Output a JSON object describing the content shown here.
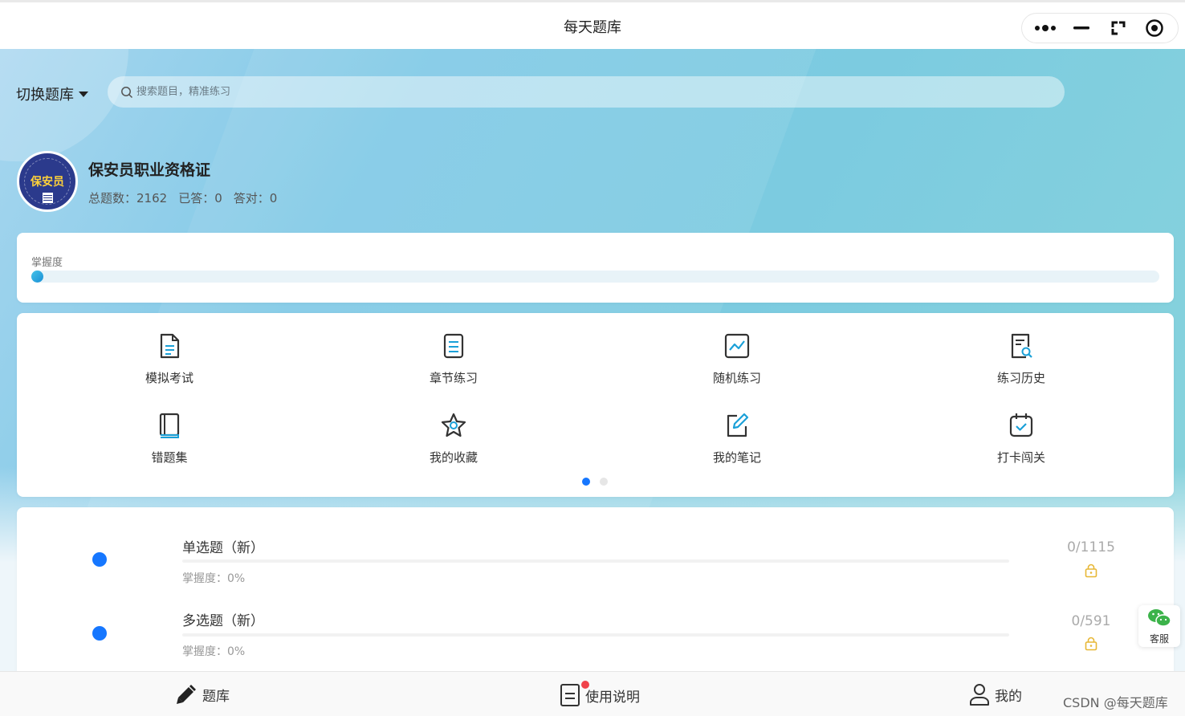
{
  "window": {
    "title": "每天题库"
  },
  "header": {
    "switch_label": "切换题库",
    "search_placeholder": "搜索题目，精准练习"
  },
  "bank": {
    "avatar_text": "保安员",
    "name": "保安员职业资格证",
    "total_label": "总题数：2162",
    "answered_label": "已答：0",
    "correct_label": "答对：0"
  },
  "mastery": {
    "label": "掌握度",
    "value_percent": 0
  },
  "grid": {
    "items": [
      {
        "label": "模拟考试",
        "icon": "exam-icon"
      },
      {
        "label": "章节练习",
        "icon": "chapter-icon"
      },
      {
        "label": "随机练习",
        "icon": "chart-icon"
      },
      {
        "label": "练习历史",
        "icon": "history-icon"
      },
      {
        "label": "错题集",
        "icon": "book-icon"
      },
      {
        "label": "我的收藏",
        "icon": "star-icon"
      },
      {
        "label": "我的笔记",
        "icon": "note-icon"
      },
      {
        "label": "打卡闯关",
        "icon": "calendar-check-icon"
      }
    ],
    "page_count": 2,
    "active_page": 0
  },
  "categories": [
    {
      "title": "单选题（新）",
      "mastery": "掌握度：0%",
      "count": "0/1115"
    },
    {
      "title": "多选题（新）",
      "mastery": "掌握度：0%",
      "count": "0/591"
    }
  ],
  "service": {
    "label": "客服"
  },
  "tabbar": {
    "tabs": [
      {
        "label": "题库",
        "icon": "pencil-icon"
      },
      {
        "label": "使用说明",
        "icon": "document-icon"
      },
      {
        "label": "我的",
        "icon": "user-icon"
      }
    ]
  },
  "watermark": "CSDN @每天题库",
  "colors": {
    "accent": "#1677ff",
    "badge": "#f0424b",
    "lock": "#e7b736",
    "wechat": "#3cb34a"
  }
}
